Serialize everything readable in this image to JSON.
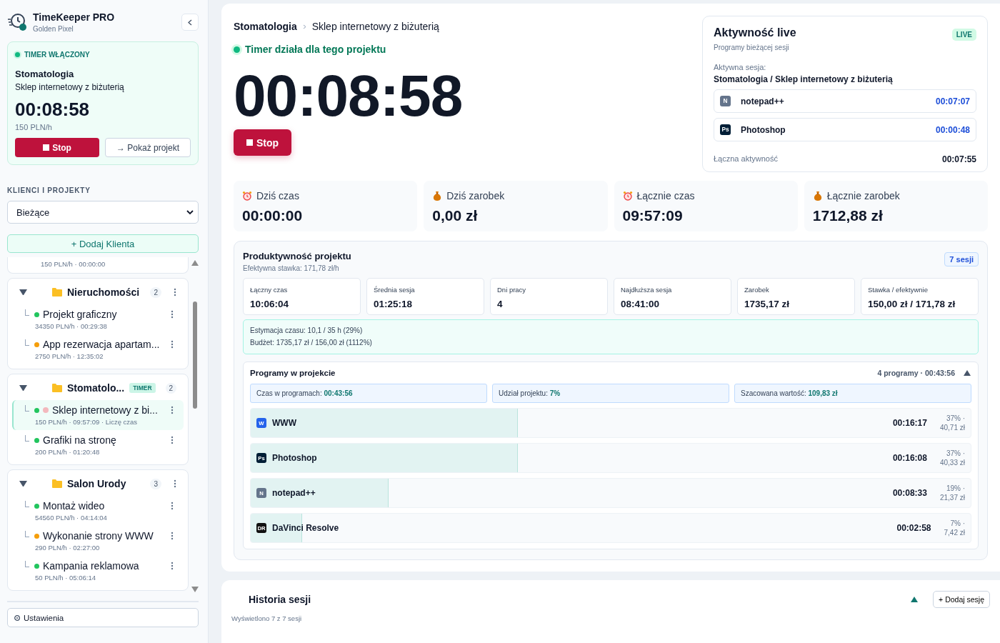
{
  "sidebar": {
    "app_title": "TimeKeeper PRO",
    "app_subtitle": "Golden Pixel",
    "timer_card": {
      "status": "TIMER WŁĄCZONY",
      "client": "Stomatologia",
      "project": "Sklep internetowy z biżuterią",
      "time": "00:08:58",
      "rate": "150 PLN/h",
      "stop_label": "Stop",
      "show_label": "→ Pokaż projekt"
    },
    "section_title": "KLIENCI I PROJEKTY",
    "filter": {
      "value": "Bieżące"
    },
    "add_client_label": "+ Dodaj Klienta",
    "clipped_meta": "150 PLN/h · 00:00:00",
    "clients": [
      {
        "name": "Nieruchomości",
        "count": "2",
        "expanded": true,
        "projects": [
          {
            "name": "Projekt graficzny",
            "meta": "34350 PLN/h · 00:29:38",
            "color": "#22c55e",
            "selected": false,
            "recording": false
          },
          {
            "name": "App rezerwacja apartam...",
            "meta": "2750 PLN/h · 12:35:02",
            "color": "#f59e0b",
            "selected": false,
            "recording": false
          }
        ]
      },
      {
        "name": "Stomatolo...",
        "badge": "TIMER",
        "count": "2",
        "expanded": true,
        "projects": [
          {
            "name": "Sklep internetowy z bi...",
            "meta": "150 PLN/h · 09:57:09 · Liczę czas",
            "color": "#22c55e",
            "selected": true,
            "recording": true
          },
          {
            "name": "Grafiki na stronę",
            "meta": "200 PLN/h · 01:20:48",
            "color": "#22c55e",
            "selected": false,
            "recording": false
          }
        ]
      },
      {
        "name": "Salon Urody",
        "count": "3",
        "expanded": true,
        "projects": [
          {
            "name": "Montaż wideo",
            "meta": "54560 PLN/h · 04:14:04",
            "color": "#22c55e",
            "selected": false,
            "recording": false
          },
          {
            "name": "Wykonanie strony WWW",
            "meta": "290 PLN/h · 02:27:00",
            "color": "#f59e0b",
            "selected": false,
            "recording": false
          },
          {
            "name": "Kampania reklamowa",
            "meta": "50 PLN/h · 05:06:14",
            "color": "#22c55e",
            "selected": false,
            "recording": false
          }
        ]
      }
    ],
    "settings_label": "Ustawienia"
  },
  "main": {
    "breadcrumb": {
      "client": "Stomatologia",
      "project": "Sklep internetowy z biżuterią"
    },
    "status": "Timer działa dla tego projektu",
    "timer": "00:08:58",
    "stop_label": "Stop",
    "live": {
      "title": "Aktywność live",
      "badge": "LIVE",
      "subtitle": "Programy bieżącej sesji",
      "session_label": "Aktywna sesja:",
      "session": "Stomatologia / Sklep internetowy z biżuterią",
      "apps": [
        {
          "icon_text": "N",
          "color": "#64748b",
          "name": "notepad++",
          "time": "00:07:07"
        },
        {
          "icon_text": "Ps",
          "color": "#001e36",
          "name": "Photoshop",
          "time": "00:00:48"
        }
      ],
      "total_label": "Łączna aktywność",
      "total": "00:07:55"
    },
    "stats": [
      {
        "kind": "time",
        "label": "Dziś czas",
        "value": "00:00:00"
      },
      {
        "kind": "money",
        "label": "Dziś zarobek",
        "value": "0,00 zł"
      },
      {
        "kind": "time",
        "label": "Łącznie czas",
        "value": "09:57:09"
      },
      {
        "kind": "money",
        "label": "Łącznie zarobek",
        "value": "1712,88 zł"
      }
    ],
    "productivity": {
      "title": "Produktywność projektu",
      "subtitle": "Efektywna stawka: 171,78 zł/h",
      "badge": "7 sesji",
      "metrics": [
        {
          "label": "Łączny czas",
          "value": "10:06:04"
        },
        {
          "label": "Średnia sesja",
          "value": "01:25:18"
        },
        {
          "label": "Dni pracy",
          "value": "4"
        },
        {
          "label": "Najdłuższa sesja",
          "value": "08:41:00"
        },
        {
          "label": "Zarobek",
          "value": "1735,17 zł"
        },
        {
          "label": "Stawka / efektywnie",
          "value": "150,00 zł / 171,78 zł"
        }
      ],
      "estimate": [
        "Estymacja czasu: 10,1 / 35 h (29%)",
        "Budżet: 1735,17 zł / 156,00 zł (1112%)"
      ],
      "programs": {
        "title": "Programy w projekcie",
        "summary": "4 programy · 00:43:56",
        "expanded": true,
        "chips": [
          {
            "label": "Czas w programach:",
            "value": "00:43:56"
          },
          {
            "label": "Udział projektu:",
            "value": "7%"
          },
          {
            "label": "Szacowana wartość:",
            "value": "109,83 zł"
          }
        ],
        "rows": [
          {
            "icon_text": "W",
            "color": "#2563eb",
            "name": "WWW",
            "time": "00:16:17",
            "share": "37% ·",
            "value": "40,71 zł",
            "level": 0.37
          },
          {
            "icon_text": "Ps",
            "color": "#001e36",
            "name": "Photoshop",
            "time": "00:16:08",
            "share": "37% ·",
            "value": "40,33 zł",
            "level": 0.37
          },
          {
            "icon_text": "N",
            "color": "#64748b",
            "name": "notepad++",
            "time": "00:08:33",
            "share": "19% ·",
            "value": "21,37 zł",
            "level": 0.19
          },
          {
            "icon_text": "DR",
            "color": "#111111",
            "name": "DaVinci Resolve",
            "time": "00:02:58",
            "share": "7% ·",
            "value": "7,42 zł",
            "level": 0.07
          }
        ]
      }
    },
    "history": {
      "title": "Historia sesji",
      "expanded": true,
      "add_label": "+ Dodaj sesję",
      "footer": "Wyświetlono 7 z 7 sesji"
    }
  }
}
